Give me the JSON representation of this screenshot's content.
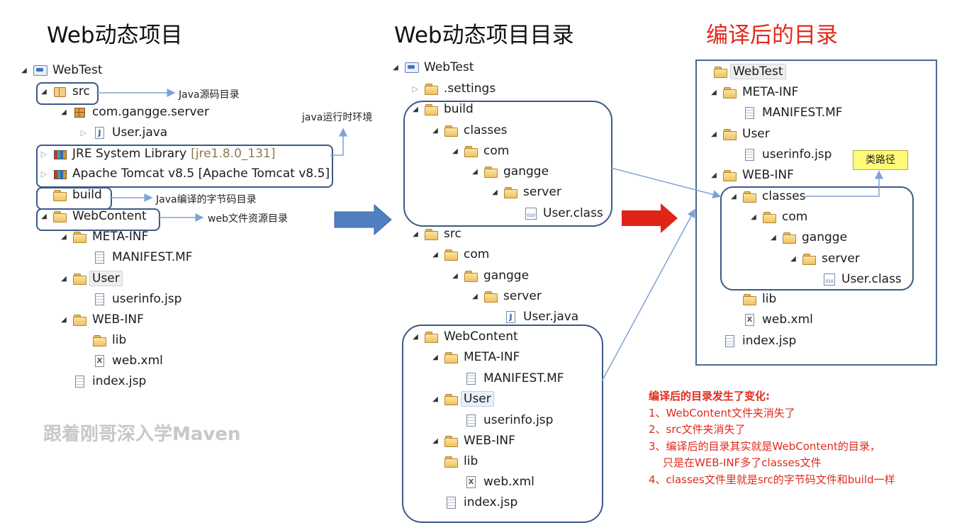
{
  "titles": {
    "left": "Web动态项目",
    "middle": "Web动态项目目录",
    "right": "编译后的目录"
  },
  "left_tree": [
    {
      "label": "WebTest",
      "icon": "project-icon",
      "toggle": "open"
    },
    {
      "label": "src",
      "icon": "source-folder-icon",
      "toggle": "open"
    },
    {
      "label": "com.gangge.server",
      "icon": "package-icon",
      "toggle": "open"
    },
    {
      "label": "User.java",
      "icon": "java-file-icon",
      "toggle": "closed"
    },
    {
      "label": "JRE System Library",
      "suffix": "[jre1.8.0_131]",
      "icon": "library-icon",
      "toggle": "closed"
    },
    {
      "label": "Apache Tomcat v8.5 [Apache Tomcat v8.5]",
      "icon": "library-icon",
      "toggle": "closed"
    },
    {
      "label": "build",
      "icon": "folder-icon",
      "toggle": "none"
    },
    {
      "label": "WebContent",
      "icon": "folder-icon",
      "toggle": "open"
    },
    {
      "label": "META-INF",
      "icon": "folder-icon",
      "toggle": "open"
    },
    {
      "label": "MANIFEST.MF",
      "icon": "file-icon",
      "toggle": "none"
    },
    {
      "label": "User",
      "icon": "folder-icon",
      "toggle": "open"
    },
    {
      "label": "userinfo.jsp",
      "icon": "file-icon",
      "toggle": "none"
    },
    {
      "label": "WEB-INF",
      "icon": "folder-icon",
      "toggle": "open"
    },
    {
      "label": "lib",
      "icon": "folder-icon",
      "toggle": "none"
    },
    {
      "label": "web.xml",
      "icon": "xml-file-icon",
      "toggle": "none"
    },
    {
      "label": "index.jsp",
      "icon": "file-icon",
      "toggle": "none"
    }
  ],
  "annotations": {
    "src": "Java源码目录",
    "jre": "java运行时环境",
    "build": "Java编译的字节码目录",
    "webcontent": "web文件资源目录",
    "classpath": "类路径"
  },
  "middle_tree": [
    {
      "label": "WebTest",
      "icon": "project-icon",
      "toggle": "open"
    },
    {
      "label": ".settings",
      "icon": "folder-icon",
      "toggle": "closed"
    },
    {
      "label": "build",
      "icon": "folder-icon",
      "toggle": "open"
    },
    {
      "label": "classes",
      "icon": "folder-icon",
      "toggle": "open"
    },
    {
      "label": "com",
      "icon": "folder-icon",
      "toggle": "open"
    },
    {
      "label": "gangge",
      "icon": "folder-icon",
      "toggle": "open"
    },
    {
      "label": "server",
      "icon": "folder-icon",
      "toggle": "open"
    },
    {
      "label": "User.class",
      "icon": "class-file-icon",
      "toggle": "none"
    },
    {
      "label": "src",
      "icon": "folder-icon",
      "toggle": "open"
    },
    {
      "label": "com",
      "icon": "folder-icon",
      "toggle": "open"
    },
    {
      "label": "gangge",
      "icon": "folder-icon",
      "toggle": "open"
    },
    {
      "label": "server",
      "icon": "folder-icon",
      "toggle": "open"
    },
    {
      "label": "User.java",
      "icon": "java-file-icon",
      "toggle": "none"
    },
    {
      "label": "WebContent",
      "icon": "folder-icon",
      "toggle": "open"
    },
    {
      "label": "META-INF",
      "icon": "folder-icon",
      "toggle": "open"
    },
    {
      "label": "MANIFEST.MF",
      "icon": "file-icon",
      "toggle": "none"
    },
    {
      "label": "User",
      "icon": "folder-icon",
      "toggle": "open"
    },
    {
      "label": "userinfo.jsp",
      "icon": "file-icon",
      "toggle": "none"
    },
    {
      "label": "WEB-INF",
      "icon": "folder-icon",
      "toggle": "open"
    },
    {
      "label": "lib",
      "icon": "folder-icon",
      "toggle": "none"
    },
    {
      "label": "web.xml",
      "icon": "xml-file-icon",
      "toggle": "none"
    },
    {
      "label": "index.jsp",
      "icon": "file-icon",
      "toggle": "none"
    }
  ],
  "right_tree": [
    {
      "label": "WebTest",
      "icon": "folder-icon",
      "toggle": "none"
    },
    {
      "label": "META-INF",
      "icon": "folder-icon",
      "toggle": "open"
    },
    {
      "label": "MANIFEST.MF",
      "icon": "file-icon",
      "toggle": "none"
    },
    {
      "label": "User",
      "icon": "folder-icon",
      "toggle": "open"
    },
    {
      "label": "userinfo.jsp",
      "icon": "file-icon",
      "toggle": "none"
    },
    {
      "label": "WEB-INF",
      "icon": "folder-icon",
      "toggle": "open"
    },
    {
      "label": "classes",
      "icon": "folder-icon",
      "toggle": "open"
    },
    {
      "label": "com",
      "icon": "folder-icon",
      "toggle": "open"
    },
    {
      "label": "gangge",
      "icon": "folder-icon",
      "toggle": "open"
    },
    {
      "label": "server",
      "icon": "folder-icon",
      "toggle": "open"
    },
    {
      "label": "User.class",
      "icon": "class-file-icon",
      "toggle": "none"
    },
    {
      "label": "lib",
      "icon": "folder-icon",
      "toggle": "none"
    },
    {
      "label": "web.xml",
      "icon": "xml-file-icon",
      "toggle": "none"
    },
    {
      "label": "index.jsp",
      "icon": "file-icon",
      "toggle": "none"
    }
  ],
  "watermark": "跟着刚哥深入学Maven",
  "notes": {
    "heading": "编译后的目录发生了变化:",
    "items": [
      "1、WebContent文件夹消失了",
      "2、src文件夹消失了",
      "3、编译后的目录其实就是WebContent的目录，",
      "只是在WEB-INF多了classes文件",
      "4、classes文件里就是src的字节码文件和build一样"
    ]
  },
  "colors": {
    "title_red": "#e12a1c",
    "box_border": "#3b5a86",
    "arrow_blue": "#4f7fc0",
    "arrow_red": "#e02418",
    "connector": "#7ea3d6"
  }
}
